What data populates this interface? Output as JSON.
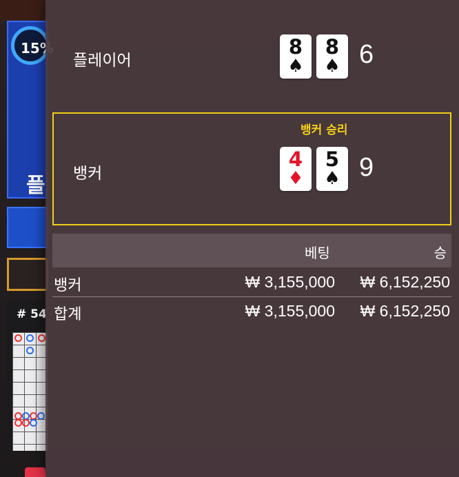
{
  "background": {
    "progress_text": "15%",
    "player_glyph": "플",
    "roadmap_label": "# 54"
  },
  "result": {
    "player": {
      "label": "플레이어",
      "cards": [
        {
          "rank": "8",
          "suit": "♠",
          "color": "black"
        },
        {
          "rank": "8",
          "suit": "♠",
          "color": "black"
        }
      ],
      "score": "6"
    },
    "banker": {
      "label": "뱅커",
      "cards": [
        {
          "rank": "4",
          "suit": "♦",
          "color": "red"
        },
        {
          "rank": "5",
          "suit": "♠",
          "color": "black"
        }
      ],
      "score": "9"
    },
    "winner_text": "뱅커 승리",
    "winner_color": "#f3cf18"
  },
  "bets": {
    "header": {
      "bet": "베팅",
      "win": "승"
    },
    "rows": [
      {
        "label": "뱅커",
        "bet": "₩ 3,155,000",
        "win": "₩ 6,152,250"
      },
      {
        "label": "합계",
        "bet": "₩ 3,155,000",
        "win": "₩ 6,152,250"
      }
    ]
  },
  "colors": {
    "panel_bg": "#4a3a3e",
    "highlight": "#f3cf18",
    "red_suit": "#e4142a"
  }
}
